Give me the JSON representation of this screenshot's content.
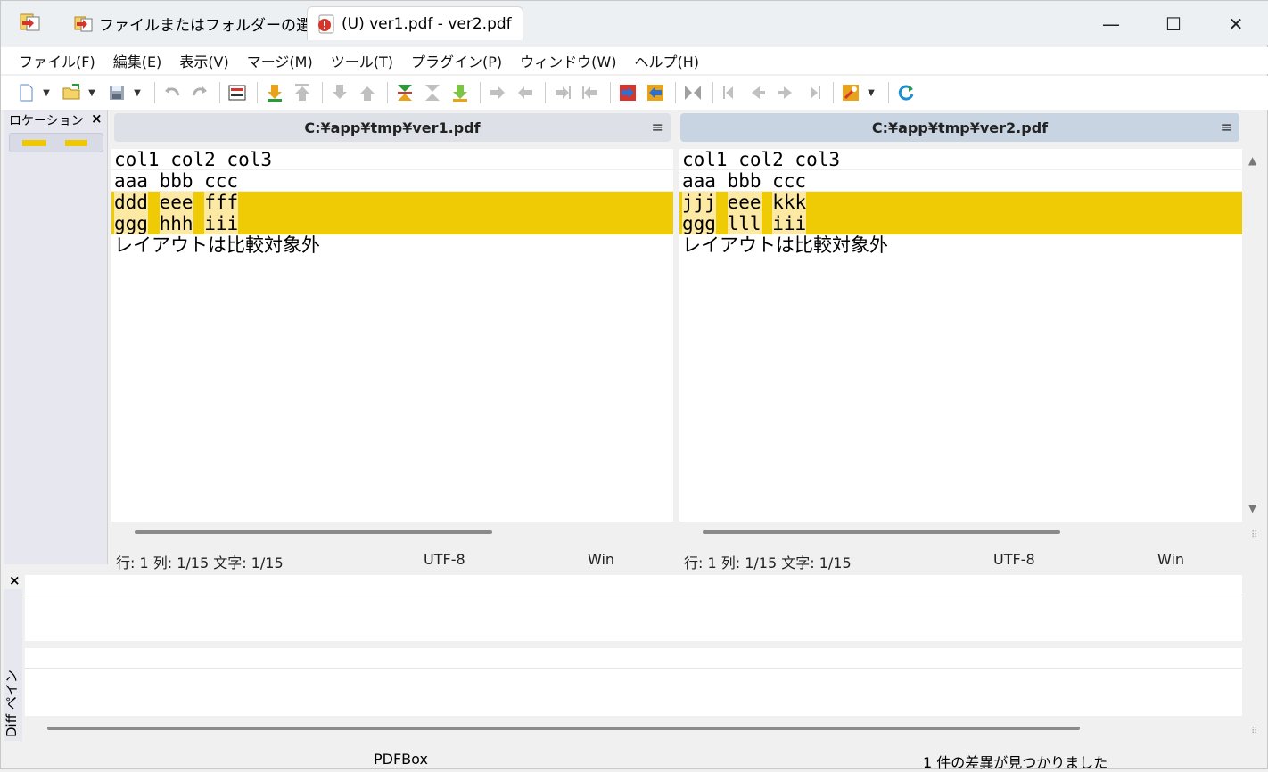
{
  "titlebar": {
    "tabs": [
      {
        "label": "ファイルまたはフォルダーの選択",
        "icon": "folder-compare-icon"
      },
      {
        "label": "(U) ver1.pdf - ver2.pdf",
        "icon": "pdf-icon"
      }
    ],
    "minimize": "—",
    "maximize": "☐",
    "close": "✕"
  },
  "menu": [
    "ファイル(F)",
    "編集(E)",
    "表示(V)",
    "マージ(M)",
    "ツール(T)",
    "プラグイン(P)",
    "ウィンドウ(W)",
    "ヘルプ(H)"
  ],
  "location_pane": {
    "title": "ロケーション ペイン",
    "close": "×"
  },
  "left": {
    "path": "C:¥app¥tmp¥ver1.pdf",
    "menu_icon": "≡",
    "lines": [
      "col1 col2 col3",
      "aaa bbb ccc",
      "ddd eee fff",
      "ggg hhh iii",
      "レイアウトは比較対象外"
    ],
    "status": {
      "position": "行: 1  列: 1/15  文字: 1/15",
      "encoding": "UTF-8",
      "eol": "Win"
    }
  },
  "right": {
    "path": "C:¥app¥tmp¥ver2.pdf",
    "menu_icon": "≡",
    "lines": [
      "col1 col2 col3",
      "aaa bbb ccc",
      "jjj eee kkk",
      "ggg lll iii",
      "レイアウトは比較対象外"
    ],
    "status": {
      "position": "行: 1  列: 1/15  文字: 1/15",
      "encoding": "UTF-8",
      "eol": "Win"
    }
  },
  "diff_pane": {
    "label": "Diff ペイン",
    "close": "×"
  },
  "bottom_status": {
    "plugin": "PDFBox",
    "message": "1 件の差異が見つかりました"
  },
  "colors": {
    "diff_line": "#efcb06",
    "diff_word": "#fce9a4",
    "accent": "#c9d4e2"
  }
}
